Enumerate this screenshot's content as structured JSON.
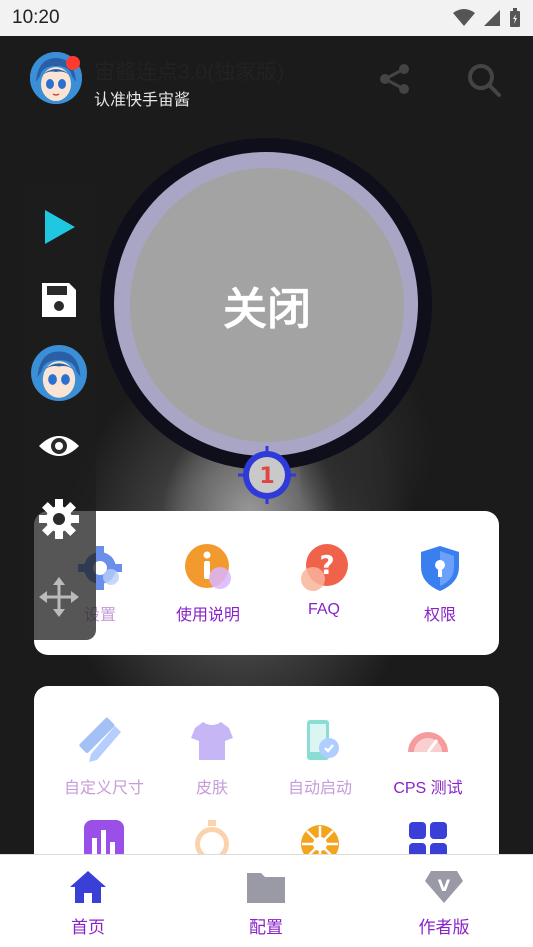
{
  "status_bar": {
    "time": "10:20"
  },
  "header": {
    "title": "宙酱连点3.0(独家版)",
    "subtitle": "认准快手宙酱"
  },
  "main_button": {
    "label": "关闭"
  },
  "target_marker": {
    "number": "1"
  },
  "floating_toolbar": {
    "items": [
      "play-icon",
      "save-icon",
      "avatar-icon",
      "eye-icon",
      "gear-icon",
      "move-icon"
    ]
  },
  "quick_actions": {
    "items": [
      {
        "label": "设置",
        "icon": "gear-icon"
      },
      {
        "label": "使用说明",
        "icon": "info-icon"
      },
      {
        "label": "FAQ",
        "icon": "question-icon"
      },
      {
        "label": "权限",
        "icon": "shield-lock-icon"
      }
    ]
  },
  "features": {
    "items": [
      {
        "label": "自定义尺寸",
        "icon": "ruler-pencil-icon"
      },
      {
        "label": "皮肤",
        "icon": "tshirt-icon"
      },
      {
        "label": "自动启动",
        "icon": "phone-link-icon"
      },
      {
        "label": "CPS 测试",
        "icon": "speedometer-icon"
      }
    ],
    "row2_icons": [
      "bar-chart-icon",
      "stopwatch-icon",
      "aperture-icon",
      "apps-grid-icon"
    ]
  },
  "bottom_nav": {
    "items": [
      {
        "label": "首页",
        "icon": "home-icon"
      },
      {
        "label": "配置",
        "icon": "folder-icon"
      },
      {
        "label": "作者版",
        "icon": "vip-diamond-icon"
      }
    ]
  },
  "colors": {
    "accent": "#8a22c8",
    "primary_blue": "#3a3fd8",
    "play": "#1fc8e0"
  }
}
